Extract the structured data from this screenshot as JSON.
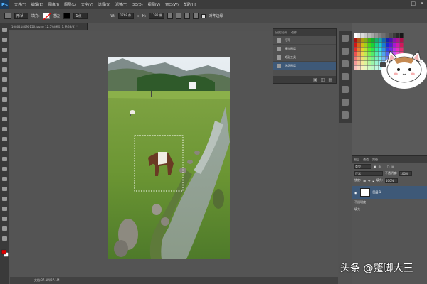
{
  "app": {
    "logo": "Ps"
  },
  "menu": [
    "文件(F)",
    "编辑(E)",
    "图像(I)",
    "图层(L)",
    "文字(Y)",
    "选择(S)",
    "滤镜(T)",
    "3D(D)",
    "视图(V)",
    "窗口(W)",
    "帮助(H)"
  ],
  "window_controls": {
    "minimize": "—",
    "restore": "□",
    "close": "✕"
  },
  "options": {
    "shape_mode": "形状",
    "fill_label": "填充:",
    "stroke_label": "描边:",
    "stroke_width": "1点",
    "w_label": "W:",
    "w_value": "1768 像",
    "h_label": "H:",
    "h_value": "1182 像",
    "align_edges": "对齐边缘"
  },
  "document": {
    "tab_title": "1080418090156.jpg @ 12.5%(图层 1, RGB/8) *",
    "status": "文档:37.1M/37.1M"
  },
  "history": {
    "tabs": [
      "历史记录",
      "动作"
    ],
    "items": [
      {
        "label": "打开",
        "active": false
      },
      {
        "label": "建立图层",
        "active": false
      },
      {
        "label": "矩形工具",
        "active": false
      },
      {
        "label": "选区图层",
        "active": true
      }
    ]
  },
  "layers": {
    "tabs": [
      "图层",
      "通道",
      "路径"
    ],
    "kind_label": "类型",
    "blend_mode": "正常",
    "opacity_label": "不透明度:",
    "opacity_value": "100%",
    "lock_label": "锁定:",
    "fill_label": "填充:",
    "fill_value": "100%",
    "layer_name": "图层 1",
    "note_1": "不透明度",
    "note_2": "填充"
  },
  "watermark": "头条 @蹩脚大王",
  "colors": {
    "foreground": "#e00000",
    "background": "#ffffff",
    "accent": "#3e5978"
  }
}
